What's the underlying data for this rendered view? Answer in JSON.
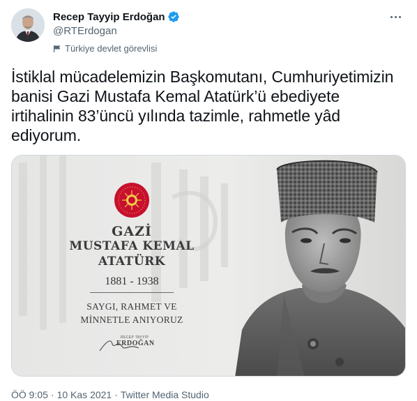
{
  "author": {
    "display_name": "Recep Tayyip Erdoğan",
    "handle": "@RTErdogan",
    "label": "Türkiye devlet görevlisi",
    "verified_icon": "verified-badge-icon",
    "flag_icon": "flag-icon",
    "more_icon": "more-options-icon"
  },
  "tweet": {
    "text": "İstiklal mücadelemizin Başkomutanı, Cumhuriyetimizin banisi Gazi Mustafa Kemal Atatürk’ü ebediyete irtihalinin 83’üncü yılında tazimle, rahmetle yâd ediyorum."
  },
  "media": {
    "line1": "GAZİ",
    "line2": "MUSTAFA KEMAL",
    "line3": "ATATÜRK",
    "years": "1881 - 1938",
    "tribute_line1": "SAYGI, RAHMET VE",
    "tribute_line2": "MİNNETLE ANIYORUZ",
    "signature_small": "RECEP TAYYİP",
    "signature_name": "ERDOĞAN"
  },
  "footer": {
    "time": "ÖÖ 9:05",
    "separator": "·",
    "date": "10 Kas 2021",
    "source": "Twitter Media Studio"
  },
  "colors": {
    "verified": "#1d9bf0",
    "text_primary": "#0f1419",
    "text_secondary": "#536471",
    "seal_red": "#c8102e"
  }
}
